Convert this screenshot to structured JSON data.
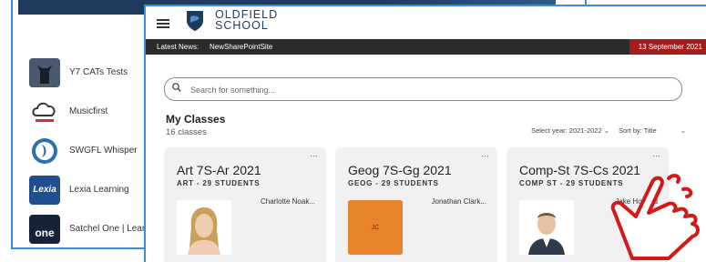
{
  "apps": [
    {
      "label": "Y7 CATs Tests",
      "icon": "cat-icon"
    },
    {
      "label": "Musicfirst",
      "icon": "cloud-icon"
    },
    {
      "label": "SWGFL Whisper",
      "icon": "whisper-icon"
    },
    {
      "label": "Lexia Learning",
      "icon": "lexia-icon",
      "logo_text": "Lexia"
    },
    {
      "label": "Satchel One | Learni",
      "icon": "satchel-icon",
      "logo_text": "one"
    }
  ],
  "header": {
    "school_line1": "OLDFIELD",
    "school_line2": "SCHOOL"
  },
  "news": {
    "label": "Latest News:",
    "item": "NewSharePointSite",
    "date": "13 September 2021"
  },
  "search": {
    "placeholder": "Search for something..."
  },
  "classes": {
    "title": "My Classes",
    "count": "16 classes",
    "year_filter": "Select year: 2021-2022 ⌄",
    "sort": "Sort by: Title",
    "sort_chevron": "⌄",
    "cards": [
      {
        "title": "Art 7S-Ar 2021",
        "subtitle": "ART - 29 STUDENTS",
        "teacher": "Charlotte Noak...",
        "menu": "…"
      },
      {
        "title": "Geog 7S-Gg 2021",
        "subtitle": "GEOG - 29 STUDENTS",
        "teacher": "Jonathan Clark...",
        "initials": "JC",
        "menu": "…"
      },
      {
        "title": "Comp-St 7S-Cs 2021",
        "subtitle": "COMP ST - 29 STUDENTS",
        "teacher": "Jake Howard",
        "menu": "…"
      }
    ]
  },
  "colors": {
    "accent_blue": "#3a8fd6",
    "news_bar": "#2b2b2b",
    "date_badge": "#a61c1c",
    "initials_bg": "#e8832a",
    "hand_outline": "#d11b1b"
  }
}
